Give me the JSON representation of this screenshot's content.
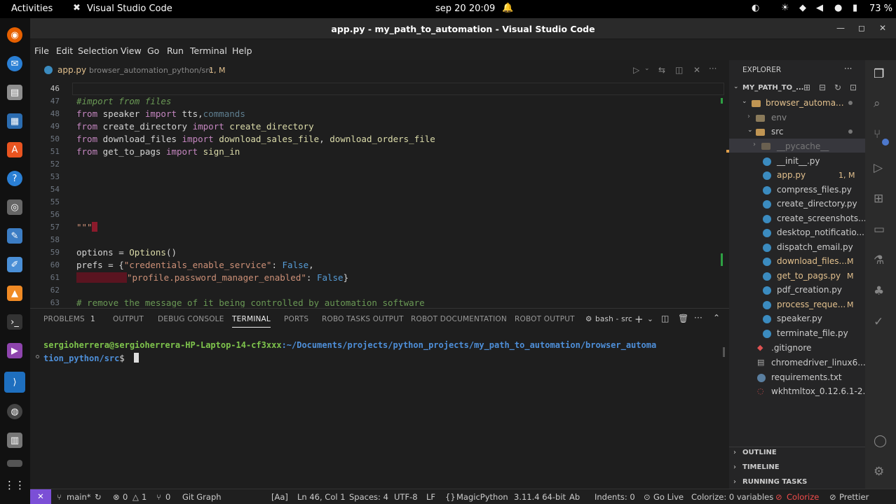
{
  "topbar": {
    "activities": "Activities",
    "app_name": "Visual Studio Code",
    "datetime": "sep 20  20:09",
    "battery": "73 %"
  },
  "window": {
    "title": "app.py - my_path_to_automation - Visual Studio Code"
  },
  "menu": [
    "File",
    "Edit",
    "Selection",
    "View",
    "Go",
    "Run",
    "Terminal",
    "Help"
  ],
  "editor_tab": {
    "filename": "app.py",
    "path": "browser_automation_python/src",
    "badge": "1, M"
  },
  "code_lines": [
    {
      "n": "46",
      "text": ""
    },
    {
      "n": "47",
      "text": "#import from files"
    },
    {
      "n": "48",
      "text": "from speaker import tts,commands"
    },
    {
      "n": "49",
      "text": "from create_directory import create_directory"
    },
    {
      "n": "50",
      "text": "from download_files import download_sales_file, download_orders_file"
    },
    {
      "n": "51",
      "text": "from get_to_pags import sign_in"
    },
    {
      "n": "52",
      "text": ""
    },
    {
      "n": "53",
      "text": ""
    },
    {
      "n": "54",
      "text": ""
    },
    {
      "n": "55",
      "text": ""
    },
    {
      "n": "56",
      "text": ""
    },
    {
      "n": "57",
      "text": "\"\"\""
    },
    {
      "n": "58",
      "text": ""
    },
    {
      "n": "59",
      "text": "options = Options()"
    },
    {
      "n": "60",
      "text": "prefs = {\"credentials_enable_service\": False,"
    },
    {
      "n": "61",
      "text": "\"profile.password_manager_enabled\": False}"
    },
    {
      "n": "62",
      "text": ""
    },
    {
      "n": "63",
      "text": "# remove the message of it being controlled by automation software"
    }
  ],
  "panel": {
    "tabs": [
      "PROBLEMS",
      "OUTPUT",
      "DEBUG CONSOLE",
      "TERMINAL",
      "PORTS",
      "ROBO TASKS OUTPUT",
      "ROBOT DOCUMENTATION",
      "ROBOT OUTPUT"
    ],
    "problems_count": "1",
    "shell": "bash - src"
  },
  "terminal": {
    "user_host": "sergioherrera@sergioherrera-HP-Laptop-14-cf3xxx",
    "path_line1": ":~/Documents/projects/python_projects/my_path_to_automation/browser_automa",
    "path_line2": "tion_python/src",
    "prompt": "$"
  },
  "explorer": {
    "title": "EXPLORER",
    "root": "MY_PATH_TO_...",
    "folder_main": "browser_automa...",
    "env": "env",
    "src": "src",
    "pycache": "__pycache__",
    "files": [
      {
        "name": "__init__.py",
        "badge": ""
      },
      {
        "name": "app.py",
        "badge": "1, M"
      },
      {
        "name": "compress_files.py",
        "badge": ""
      },
      {
        "name": "create_directory.py",
        "badge": ""
      },
      {
        "name": "create_screenshots....",
        "badge": ""
      },
      {
        "name": "desktop_notificatio...",
        "badge": ""
      },
      {
        "name": "dispatch_email.py",
        "badge": ""
      },
      {
        "name": "download_files....",
        "badge": "M"
      },
      {
        "name": "get_to_pags.py",
        "badge": "M"
      },
      {
        "name": "pdf_creation.py",
        "badge": ""
      },
      {
        "name": "process_reque...",
        "badge": "M"
      },
      {
        "name": "speaker.py",
        "badge": ""
      },
      {
        "name": "terminate_file.py",
        "badge": ""
      }
    ],
    "root_files": [
      ".gitignore",
      "chromedriver_linux6...",
      "requirements.txt",
      "wkhtmltox_0.12.6.1-2...."
    ],
    "sections": [
      "OUTLINE",
      "TIMELINE",
      "RUNNING TASKS"
    ]
  },
  "status": {
    "branch": "main*",
    "errors": "0",
    "warnings": "1",
    "ports": "0",
    "git_graph": "Git Graph",
    "aa": "[Aa]",
    "position": "Ln 46, Col 1",
    "spaces": "Spaces: 4",
    "encoding": "UTF-8",
    "eol": "LF",
    "language": "MagicPython",
    "interpreter": "3.11.4 64-bit",
    "ab": "Ab",
    "indents": "Indents: 0",
    "golive": "Go Live",
    "colorize_vars": "Colorize: 0 variables",
    "colorize": "Colorize",
    "prettier": "Prettier"
  },
  "colors": {
    "accent": "#007acc",
    "modified": "#e2c08d",
    "error": "#f14c4c"
  }
}
